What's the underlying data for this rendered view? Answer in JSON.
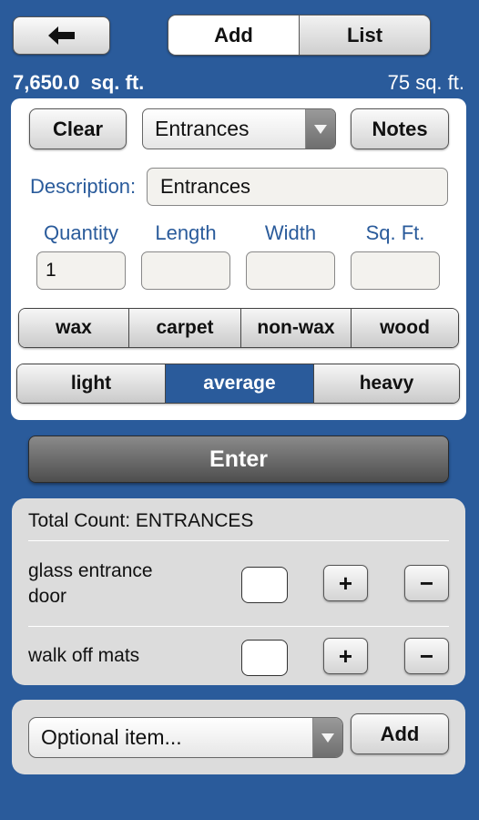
{
  "header": {
    "tabs": [
      {
        "label": "Add",
        "active": true
      },
      {
        "label": "List",
        "active": false
      }
    ],
    "back_icon": "left-arrow-icon"
  },
  "area": {
    "total": "7,650.0  sq. ft.",
    "current": "75 sq. ft."
  },
  "form": {
    "clear_label": "Clear",
    "notes_label": "Notes",
    "area_type_selected": "Entrances",
    "description_label": "Description:",
    "description_value": "Entrances",
    "columns": [
      "Quantity",
      "Length",
      "Width",
      "Sq. Ft."
    ],
    "quantity_value": "1",
    "length_value": "",
    "width_value": "",
    "sqft_value": ""
  },
  "floor_types": [
    "wax",
    "carpet",
    "non-wax",
    "wood"
  ],
  "traffic_levels": [
    {
      "label": "light",
      "active": false
    },
    {
      "label": "average",
      "active": true
    },
    {
      "label": "heavy",
      "active": false
    }
  ],
  "enter_label": "Enter",
  "count_panel": {
    "title": "Total Count: ENTRANCES",
    "items": [
      {
        "label_line1": "glass entrance",
        "label_line2": "door",
        "count": ""
      },
      {
        "label_line1": "walk off mats",
        "label_line2": "",
        "count": ""
      }
    ],
    "plus_label": "+",
    "minus_label": "−"
  },
  "optional": {
    "placeholder": "Optional item...",
    "add_label": "Add"
  },
  "colors": {
    "background": "#2a5b9b",
    "accent_label": "#2a5b9b",
    "active_segment": "#2a5b9b"
  }
}
